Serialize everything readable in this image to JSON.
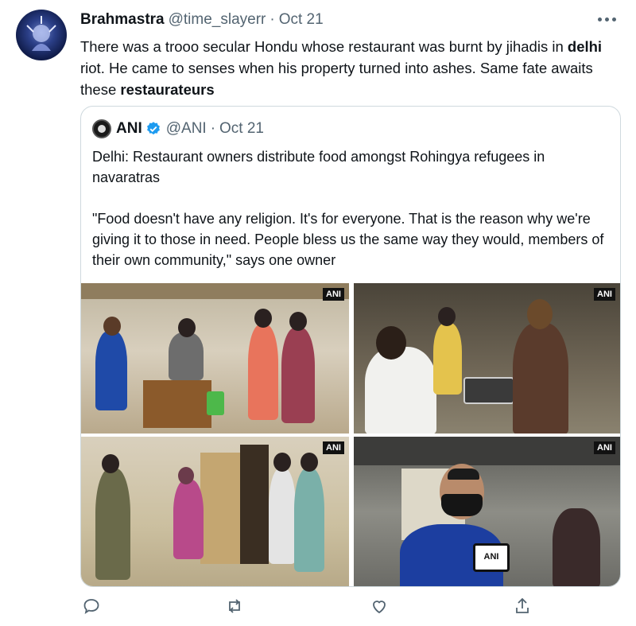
{
  "tweet": {
    "display_name": "Brahmastra",
    "handle": "@time_slayerr",
    "separator": "·",
    "date": "Oct 21",
    "text_part1": "There was a trooo secular Hondu whose restaurant was burnt by jihadis in ",
    "bold1": "delhi",
    "text_part2": " riot. He came to senses when his property turned into ashes. Same fate awaits these ",
    "bold2": "restaurateurs"
  },
  "quoted": {
    "display_name": "ANI",
    "handle": "@ANI",
    "separator": "·",
    "date": "Oct 21",
    "text": "Delhi: Restaurant owners distribute food amongst Rohingya refugees in navaratras\n\n\"Food doesn't have any religion. It's for everyone. That is the reason why we're giving it to those in need. People bless us the same way they would, members of their own community,\" says one owner",
    "photo_watermark": "ANI"
  },
  "actions": {
    "icons": [
      "reply-icon",
      "retweet-icon",
      "like-icon",
      "share-icon"
    ]
  },
  "colors": {
    "secondary_text": "#536471",
    "verified": "#1d9bf0",
    "border": "#cfd9de"
  }
}
